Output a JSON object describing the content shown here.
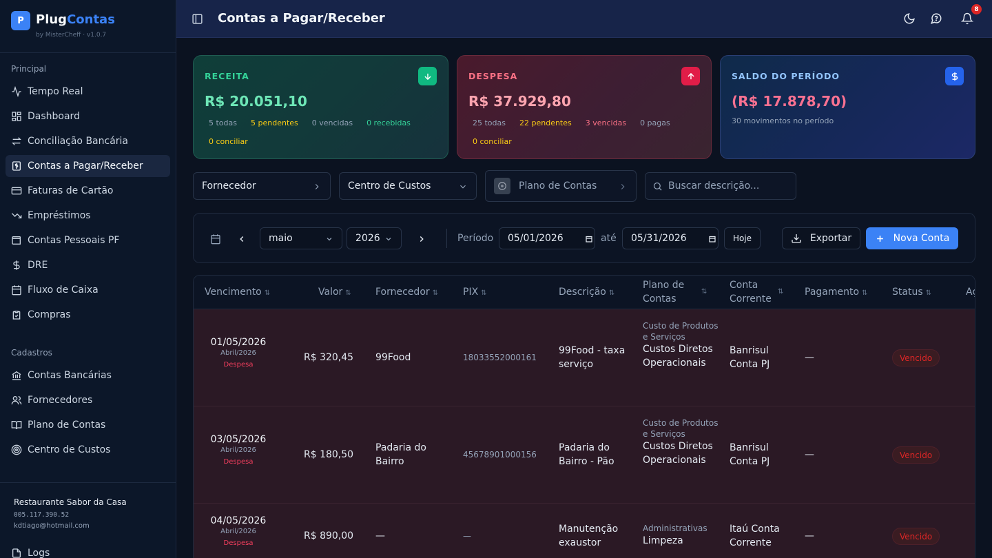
{
  "brand": {
    "logo_letter": "P",
    "name_a": "Plug",
    "name_b": "Contas",
    "sub": "by MisterCheff · v1.0.7"
  },
  "sidebar": {
    "section_main": "Principal",
    "items": [
      {
        "label": "Tempo Real",
        "icon": "activity-icon"
      },
      {
        "label": "Dashboard",
        "icon": "dashboard-icon"
      },
      {
        "label": "Conciliação Bancária",
        "icon": "arrows-swap-icon"
      },
      {
        "label": "Contas a Pagar/Receber",
        "icon": "receipt-icon"
      },
      {
        "label": "Faturas de Cartão",
        "icon": "credit-card-icon"
      },
      {
        "label": "Empréstimos",
        "icon": "trending-down-icon"
      },
      {
        "label": "Contas Pessoais PF",
        "icon": "wallet-icon"
      },
      {
        "label": "DRE",
        "icon": "dollar-icon"
      },
      {
        "label": "Fluxo de Caixa",
        "icon": "calendar-icon"
      },
      {
        "label": "Compras",
        "icon": "clipboard-icon"
      }
    ],
    "section_cad": "Cadastros",
    "cad_items": [
      {
        "label": "Contas Bancárias",
        "icon": "bank-icon"
      },
      {
        "label": "Fornecedores",
        "icon": "users-icon"
      },
      {
        "label": "Plano de Contas",
        "icon": "book-icon"
      },
      {
        "label": "Centro de Custos",
        "icon": "target-icon"
      }
    ],
    "logs_label": "Logs",
    "company": {
      "name": "Restaurante Sabor da Casa",
      "cnpj": "005.117.390.52",
      "email": "kdtiago@hotmail.com"
    }
  },
  "header": {
    "title": "Contas a Pagar/Receber",
    "notifications": "8"
  },
  "cards": {
    "receita": {
      "label": "RECEITA",
      "value": "R$ 20.051,10",
      "chips": [
        "5 todas",
        "5 pendentes",
        "0 vencidas",
        "0 recebidas",
        "0 conciliar"
      ]
    },
    "despesa": {
      "label": "DESPESA",
      "value": "R$ 37.929,80",
      "chips": [
        "25 todas",
        "22 pendentes",
        "3 vencidas",
        "0 pagas",
        "0 conciliar"
      ]
    },
    "saldo": {
      "label": "SALDO DO PERÍODO",
      "value": "(R$ 17.878,70)",
      "sub": "30 movimentos no período"
    }
  },
  "filters": {
    "fornecedor": "Fornecedor",
    "centro": "Centro de Custos",
    "plano": "Plano de Contas",
    "search_placeholder": "Buscar descrição..."
  },
  "toolbar": {
    "month": "maio",
    "year": "2026",
    "periodo_label": "Período",
    "start": "05/01/2026",
    "ate": "até",
    "end": "05/31/2026",
    "hoje": "Hoje",
    "exportar": "Exportar",
    "nova": "Nova Conta"
  },
  "table": {
    "headers": [
      "Vencimento",
      "Valor",
      "Fornecedor",
      "PIX",
      "Descrição",
      "Plano de Contas",
      "Conta Corrente",
      "Pagamento",
      "Status",
      "Ações"
    ],
    "rows": [
      {
        "date": "01/05/2026",
        "month": "Abril/2026",
        "type": "Despesa",
        "valor": "R$ 320,45",
        "fornecedor": "99Food",
        "pix": "18033552000161",
        "descricao": "99Food - taxa serviço",
        "plano_cat": "Custo de Produtos e Serviços",
        "plano_sub": "Custos Diretos Operacionais",
        "conta": "Banrisul Conta PJ",
        "pagamento": "—",
        "status": "Vencido"
      },
      {
        "date": "03/05/2026",
        "month": "Abril/2026",
        "type": "Despesa",
        "valor": "R$ 180,50",
        "fornecedor": "Padaria do Bairro",
        "pix": "45678901000156",
        "descricao": "Padaria do Bairro - Pão",
        "plano_cat": "Custo de Produtos e Serviços",
        "plano_sub": "Custos Diretos Operacionais",
        "conta": "Banrisul Conta PJ",
        "pagamento": "—",
        "status": "Vencido"
      },
      {
        "date": "04/05/2026",
        "month": "Abril/2026",
        "type": "Despesa",
        "valor": "R$ 890,00",
        "fornecedor": "—",
        "pix": "—",
        "descricao": "Manutenção exaustor",
        "plano_cat": "Administrativas",
        "plano_sub": "Limpeza",
        "conta": "Itaú Conta Corrente",
        "pagamento": "—",
        "status": "Vencido"
      }
    ]
  },
  "colors": {
    "accent": "#3b82f6",
    "receita": "#34d399",
    "despesa": "#f43f5e",
    "saldo_value": "#f87191"
  }
}
